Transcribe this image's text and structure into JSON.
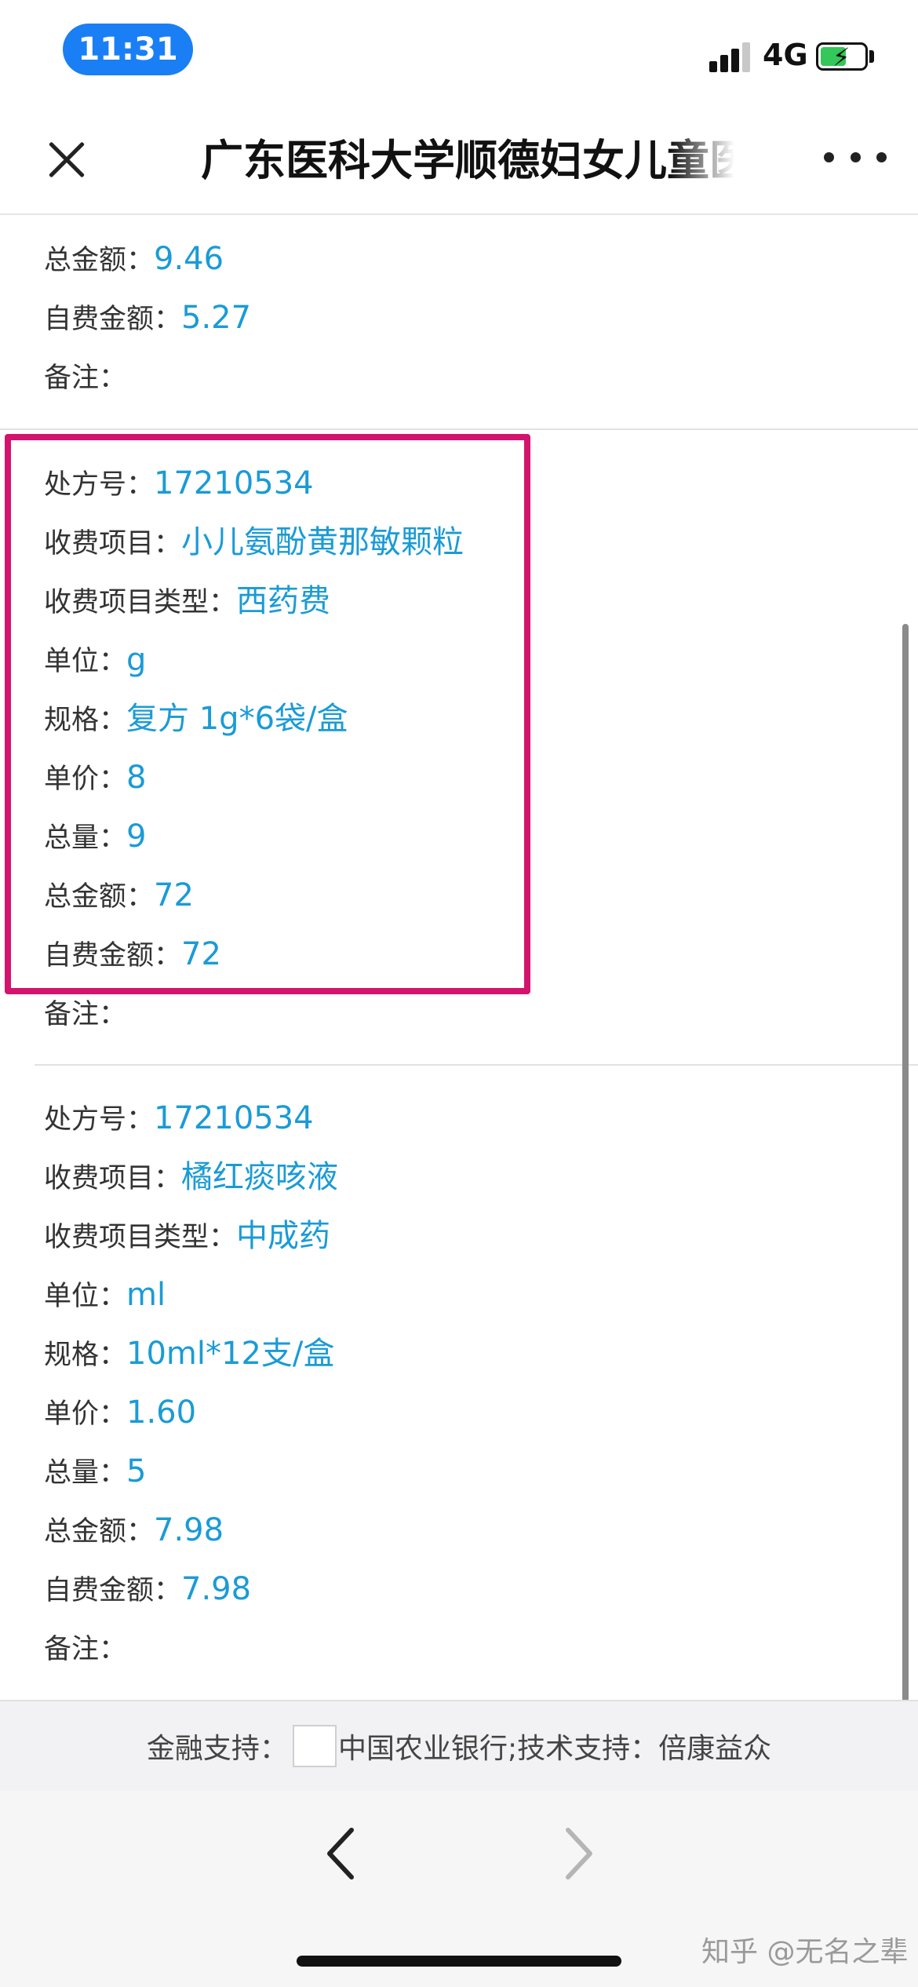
{
  "status_bar": {
    "time": "11:31",
    "network": "4G"
  },
  "nav": {
    "title": "广东医科大学顺德妇女儿童医"
  },
  "records": [
    {
      "fields": [
        {
          "label": "总金额：",
          "value": "9.46"
        },
        {
          "label": "自费金额：",
          "value": "5.27"
        },
        {
          "label": "备注：",
          "value": ""
        }
      ]
    },
    {
      "fields": [
        {
          "label": "处方号：",
          "value": "17210534"
        },
        {
          "label": "收费项目：",
          "value": "小儿氨酚黄那敏颗粒"
        },
        {
          "label": "收费项目类型：",
          "value": "西药费"
        },
        {
          "label": "单位：",
          "value": "g"
        },
        {
          "label": "规格：",
          "value": "复方 1g*6袋/盒"
        },
        {
          "label": "单价：",
          "value": "8"
        },
        {
          "label": "总量：",
          "value": "9"
        },
        {
          "label": "总金额：",
          "value": "72"
        },
        {
          "label": "自费金额：",
          "value": "72"
        },
        {
          "label": "备注：",
          "value": ""
        }
      ]
    },
    {
      "fields": [
        {
          "label": "处方号：",
          "value": "17210534"
        },
        {
          "label": "收费项目：",
          "value": "橘红痰咳液"
        },
        {
          "label": "收费项目类型：",
          "value": "中成药"
        },
        {
          "label": "单位：",
          "value": "ml"
        },
        {
          "label": "规格：",
          "value": "10ml*12支/盒"
        },
        {
          "label": "单价：",
          "value": "1.60"
        },
        {
          "label": "总量：",
          "value": "5"
        },
        {
          "label": "总金额：",
          "value": "7.98"
        },
        {
          "label": "自费金额：",
          "value": "7.98"
        },
        {
          "label": "备注：",
          "value": ""
        }
      ]
    }
  ],
  "footer": {
    "finance_label": "金融支持：",
    "bank": "中国农业银行;技术支持：倍康益众"
  },
  "toolbar": {
    "watermark": "知乎 @无名之辈"
  },
  "colors": {
    "value_blue": "#1a9bd6",
    "highlight": "#d4136e",
    "time_pill": "#1a7ff5"
  }
}
